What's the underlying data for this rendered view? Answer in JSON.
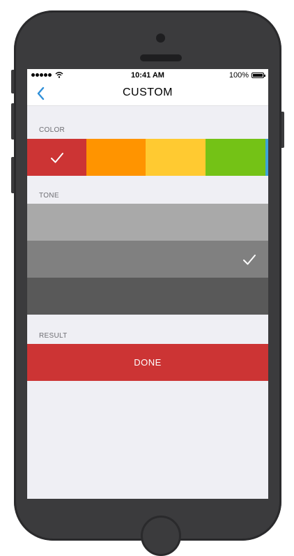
{
  "status_bar": {
    "time": "10:41 AM",
    "battery": "100%"
  },
  "nav": {
    "title": "CUSTOM"
  },
  "sections": {
    "color": "COLOR",
    "tone": "TONE",
    "result": "RESULT"
  },
  "colors": [
    {
      "hex": "#cc3434",
      "selected": true
    },
    {
      "hex": "#ff9400",
      "selected": false
    },
    {
      "hex": "#ffca31",
      "selected": false
    },
    {
      "hex": "#74c216",
      "selected": false
    },
    {
      "hex": "#3fa3d8",
      "selected": false
    }
  ],
  "tones": [
    {
      "hex": "#a9a9a9",
      "selected": false
    },
    {
      "hex": "#808080",
      "selected": true
    },
    {
      "hex": "#595959",
      "selected": false
    }
  ],
  "result": {
    "button_label": "DONE",
    "color": "#cc3434"
  },
  "icons": {
    "back": "chevron-left-icon",
    "check": "checkmark-icon"
  }
}
